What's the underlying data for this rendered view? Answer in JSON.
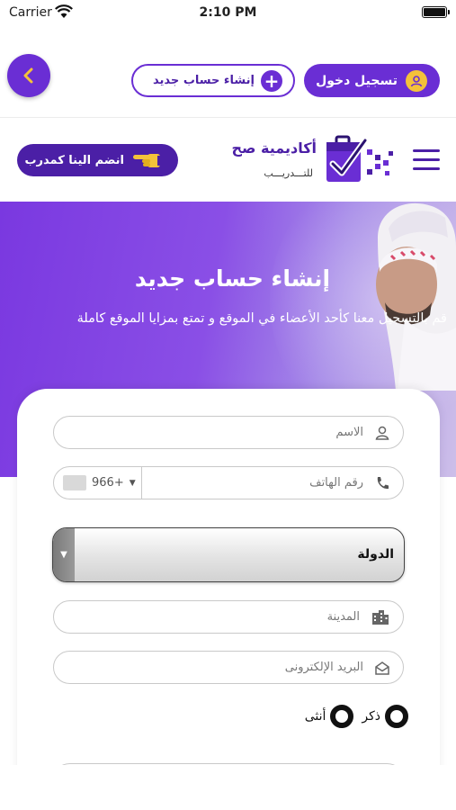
{
  "status_bar": {
    "carrier": "Carrier",
    "time": "2:10 PM"
  },
  "top_actions": {
    "login_label": "تسجيل دخول",
    "register_label": "إنشاء حساب جديد"
  },
  "header": {
    "brand_name": "أكاديمية صح",
    "brand_subtitle": "للتـــدريـــب",
    "join_trainer_label": "انضم الينا كمدرب"
  },
  "hero": {
    "title": "إنشاء حساب جديد",
    "subtitle": "قم بالتسجيل معنا كأحد الأعضاء في الموقع و تمتع بمزايا الموقع كاملة"
  },
  "form": {
    "name_placeholder": "الاسم",
    "phone_placeholder": "رقم الهاتف",
    "phone_code": "966+",
    "country_label": "الدولة",
    "city_placeholder": "المدينة",
    "email_placeholder": "البريد الإلكترونى",
    "gender_male": "ذكر",
    "gender_female": "أنثى"
  },
  "colors": {
    "primary": "#6a2ed4",
    "primary_dark": "#4b1fa6",
    "accent_yellow": "#f4c23a"
  },
  "icons": [
    "chevron-left-icon",
    "plus-icon",
    "user-icon",
    "hand-pointing-icon",
    "menu-icon",
    "person-icon",
    "phone-icon",
    "building-icon",
    "envelope-icon",
    "wifi-icon",
    "battery-icon"
  ]
}
